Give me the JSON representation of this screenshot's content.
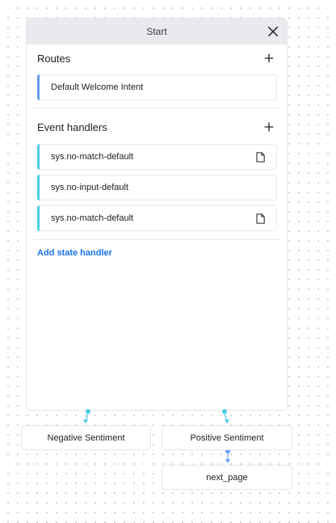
{
  "panel": {
    "title": "Start",
    "routes": {
      "title": "Routes",
      "items": [
        {
          "label": "Default Welcome Intent"
        }
      ]
    },
    "event_handlers": {
      "title": "Event handlers",
      "items": [
        {
          "label": "sys.no-match-default",
          "icon": "document-icon"
        },
        {
          "label": "sys.no-input-default"
        },
        {
          "label": "sys.no-match-default",
          "icon": "document-icon"
        }
      ]
    },
    "add_state_handler": "Add state handler"
  },
  "nodes": {
    "negative": "Negative Sentiment",
    "positive": "Positive Sentiment",
    "next_page": "next_page"
  },
  "colors": {
    "route_accent": "#669df6",
    "event_accent": "#4ecde6",
    "link": "#1a73e8",
    "connector": "#4ecde6",
    "connector_alt": "#669df6"
  }
}
